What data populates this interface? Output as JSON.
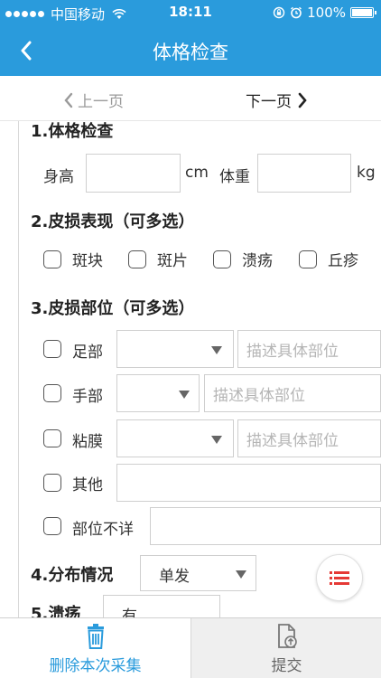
{
  "status_bar": {
    "carrier": "中国移动",
    "time": "18:11",
    "battery": "100%",
    "signal_icon": "signal-dots-icon",
    "wifi_icon": "wifi-icon",
    "lock_icon": "rotation-lock-icon",
    "alarm_icon": "alarm-icon",
    "battery_icon": "battery-icon"
  },
  "nav": {
    "title": "体格检查",
    "back_icon": "chevron-left-icon"
  },
  "pager": {
    "prev_label": "上一页",
    "next_label": "下一页"
  },
  "section1": {
    "heading": "1.体格检查",
    "height_label": "身高",
    "height_value": "",
    "height_unit": "cm",
    "weight_label": "体重",
    "weight_value": "",
    "weight_unit": "kg"
  },
  "section2": {
    "heading": "2.皮损表现（可多选）",
    "options": [
      "斑块",
      "斑片",
      "溃疡",
      "丘疹"
    ]
  },
  "section3": {
    "heading": "3.皮损部位（可多选）",
    "rows": [
      {
        "label": "足部",
        "placeholder": "描述具体部位"
      },
      {
        "label": "手部",
        "placeholder": "描述具体部位"
      },
      {
        "label": "粘膜",
        "placeholder": "描述具体部位"
      },
      {
        "label": "其他",
        "value": ""
      },
      {
        "label": "部位不详",
        "value": ""
      }
    ]
  },
  "section4": {
    "heading": "4.分布情况",
    "selected": "单发"
  },
  "section5": {
    "heading": "5.溃疡",
    "selected": "有"
  },
  "fab": {
    "icon": "list-icon"
  },
  "tabbar": {
    "delete_label": "删除本次采集",
    "delete_icon": "trash-icon",
    "submit_label": "提交",
    "submit_icon": "upload-document-icon"
  },
  "colors": {
    "brand": "#2a9bdc",
    "fab_icon": "#e53935"
  }
}
